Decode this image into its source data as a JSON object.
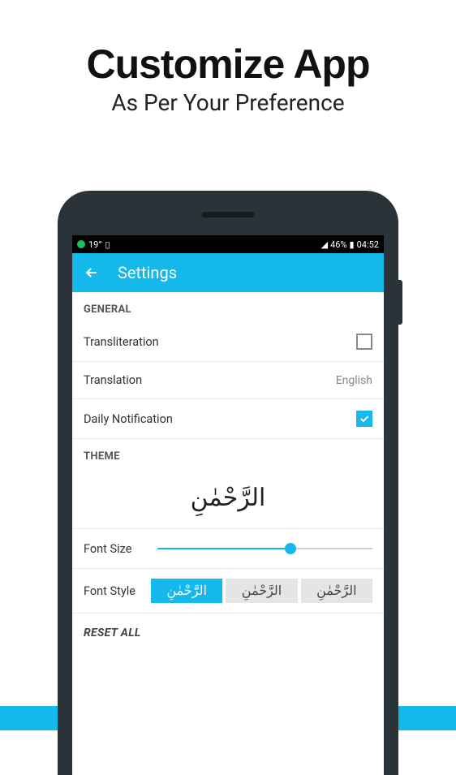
{
  "promo": {
    "title": "Customize App",
    "subtitle": "As Per Your Preference"
  },
  "statusbar": {
    "temp": "19°",
    "battery": "46%",
    "time": "04:52"
  },
  "appbar": {
    "title": "Settings"
  },
  "sections": {
    "general": {
      "header": "GENERAL",
      "transliteration": {
        "label": "Transliteration",
        "checked": false
      },
      "translation": {
        "label": "Translation",
        "value": "English"
      },
      "daily_notification": {
        "label": "Daily Notification",
        "checked": true
      }
    },
    "theme": {
      "header": "THEME",
      "arabic_preview": "الرَّحْمٰنِ",
      "font_size": {
        "label": "Font Size",
        "value_percent": 62
      },
      "font_style": {
        "label": "Font Style",
        "options": [
          {
            "text": "الرَّحْمٰنِ",
            "active": true
          },
          {
            "text": "الرَّحْمٰنِ",
            "active": false
          },
          {
            "text": "الرَّحْمٰنِ",
            "active": false
          }
        ]
      }
    },
    "reset": {
      "label": "RESET ALL"
    }
  }
}
